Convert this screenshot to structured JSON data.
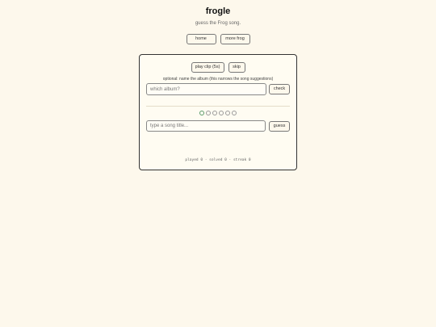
{
  "app": {
    "title": "frogle",
    "subtitle": "guess the Frog song."
  },
  "nav": {
    "home_label": "home",
    "more_frog_label": "more frog"
  },
  "game": {
    "play_clip_label": "play clip (5s)",
    "skip_label": "skip",
    "album_note": "optional: name the album (this narrows the song suggestions)",
    "album_placeholder": "which album?",
    "check_label": "check",
    "attempts_total": 6,
    "attempts_current": 1,
    "title_placeholder": "type a song title...",
    "guess_label": "guess"
  },
  "stats": {
    "text": "played 0 · solved 0 · streak 0"
  },
  "colors": {
    "background": "#fdf8ec",
    "active_dot": "#5a9a6a"
  }
}
